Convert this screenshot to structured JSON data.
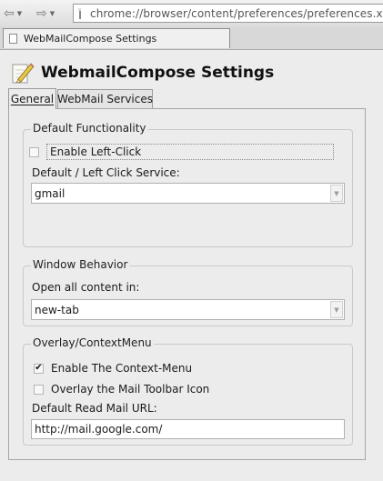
{
  "browser": {
    "url": "chrome://browser/content/preferences/preferences.xul",
    "tab_title": "WebMailCompose Settings",
    "back_arrow": "⇦",
    "forward_arrow": "⇨",
    "dropdown_glyph": "▼"
  },
  "header": {
    "title": "WebmailCompose Settings",
    "icon": "pencil-icon"
  },
  "tabs": [
    {
      "label": "General",
      "selected": true
    },
    {
      "label": "WebMail Services",
      "selected": false
    }
  ],
  "default_functionality": {
    "legend": "Default Functionality",
    "enable_left_click": {
      "label": "Enable Left-Click",
      "checked": false
    },
    "service_label": "Default / Left Click Service:",
    "service_value": "gmail"
  },
  "window_behavior": {
    "legend": "Window Behavior",
    "open_label": "Open all content in:",
    "open_value": "new-tab"
  },
  "overlay": {
    "legend": "Overlay/ContextMenu",
    "enable_context": {
      "label": "Enable The Context-Menu",
      "checked": true,
      "mark": "✔"
    },
    "overlay_toolbar": {
      "label": "Overlay the Mail Toolbar Icon",
      "checked": false
    },
    "read_url_label": "Default Read Mail URL:",
    "read_url_value": "http://mail.google.com/"
  },
  "colors": {
    "background": "#ececec",
    "border": "#a6a6a6"
  }
}
